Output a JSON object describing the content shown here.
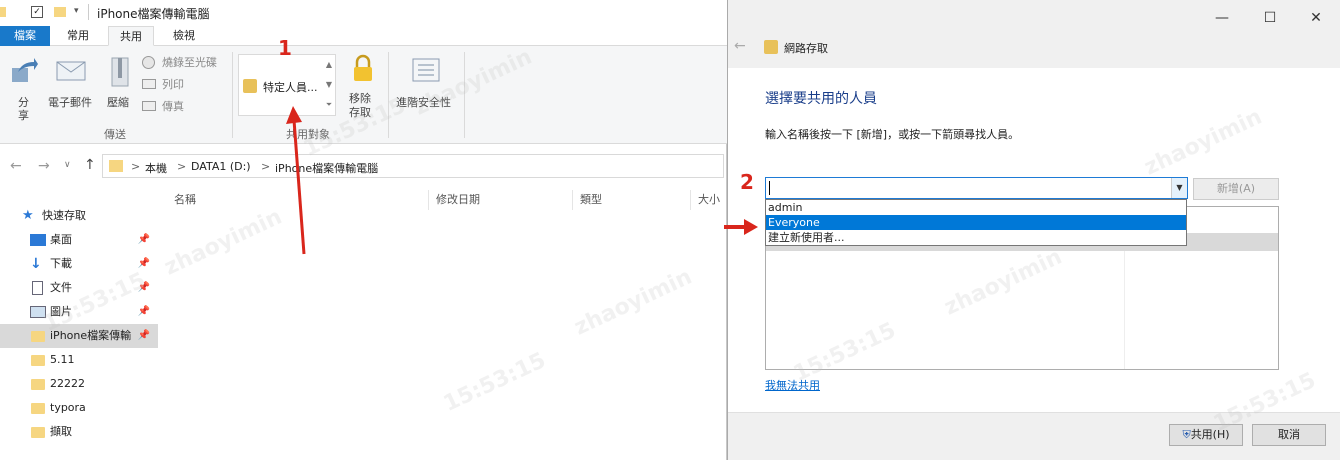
{
  "explorer": {
    "title": "iPhone檔案傳輸電腦",
    "tabs": [
      "檔案",
      "常用",
      "共用",
      "檢視"
    ],
    "ribbon": {
      "share": "分\n享",
      "email": "電子郵件",
      "zip": "壓縮",
      "burn": "燒錄至光碟",
      "print": "列印",
      "fax": "傳真",
      "specific_people": "特定人員...",
      "remove_access_1": "移除",
      "remove_access_2": "存取",
      "advanced_security": "進階安全性",
      "group_send": "傳送",
      "group_share_with": "共用對象"
    },
    "address": {
      "crumbs": [
        "本機",
        "DATA1 (D:)",
        "iPhone檔案傳輸電腦"
      ],
      "separator": ">"
    },
    "columns": [
      "名稱",
      "修改日期",
      "類型",
      "大小"
    ],
    "nav": {
      "quick_access": "快速存取",
      "items": [
        {
          "label": "桌面",
          "icon": "desktop-icon",
          "pinned": true
        },
        {
          "label": "下載",
          "icon": "download-icon",
          "pinned": true
        },
        {
          "label": "文件",
          "icon": "document-icon",
          "pinned": true
        },
        {
          "label": "圖片",
          "icon": "picture-icon",
          "pinned": true
        },
        {
          "label": "iPhone檔案傳輸",
          "icon": "folder-icon",
          "pinned": true,
          "selected": true
        },
        {
          "label": "5.11",
          "icon": "folder-icon",
          "pinned": false
        },
        {
          "label": "22222",
          "icon": "folder-icon",
          "pinned": false
        },
        {
          "label": "typora",
          "icon": "folder-icon",
          "pinned": false
        },
        {
          "label": "擷取",
          "icon": "folder-icon",
          "pinned": false
        }
      ]
    }
  },
  "dialog": {
    "title": "網路存取",
    "heading": "選擇要共用的人員",
    "instruction": "輸入名稱後按一下 [新增]，或按一下箭頭尋找人員。",
    "add_button": "新增(A)",
    "combo_value": "",
    "dropdown_options": [
      "admin",
      "Everyone",
      "建立新使用者..."
    ],
    "selected_option": "Everyone",
    "help_link": "我無法共用",
    "share_button": "共用(H)",
    "cancel_button": "取消"
  },
  "annotations": {
    "step1": "1",
    "step2": "2"
  },
  "watermarks": [
    "zhaoyimin",
    "15:53:15"
  ],
  "colors": {
    "accent": "#0078d7",
    "annotation": "#d9261c",
    "folder": "#f6d681"
  }
}
